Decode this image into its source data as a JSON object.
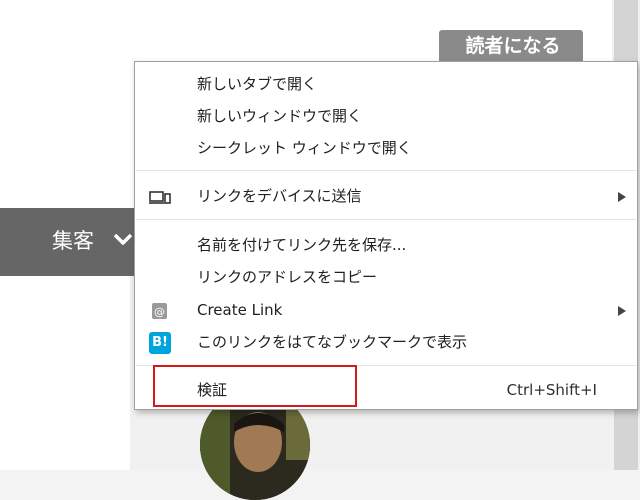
{
  "page": {
    "subscribe_button": "読者になる",
    "nav_label": "集客"
  },
  "context_menu": {
    "items": [
      {
        "label": "新しいタブで開く"
      },
      {
        "label": "新しいウィンドウで開く"
      },
      {
        "label": "シークレット ウィンドウで開く"
      },
      {
        "label": "リンクをデバイスに送信",
        "icon": "device-send-icon",
        "has_submenu": true
      },
      {
        "label": "名前を付けてリンク先を保存..."
      },
      {
        "label": "リンクのアドレスをコピー"
      },
      {
        "label": "Create Link",
        "icon": "create-link-icon",
        "has_submenu": true
      },
      {
        "label": "このリンクをはてなブックマークで表示",
        "icon": "hatena-bookmark-icon",
        "icon_text": "B!"
      },
      {
        "label": "検証",
        "shortcut": "Ctrl+Shift+I"
      }
    ]
  },
  "colors": {
    "highlight": "#d11a1a",
    "hatena_blue": "#00a4de",
    "nav_bg": "#666666",
    "subscribe_bg": "#8a8a8a"
  }
}
